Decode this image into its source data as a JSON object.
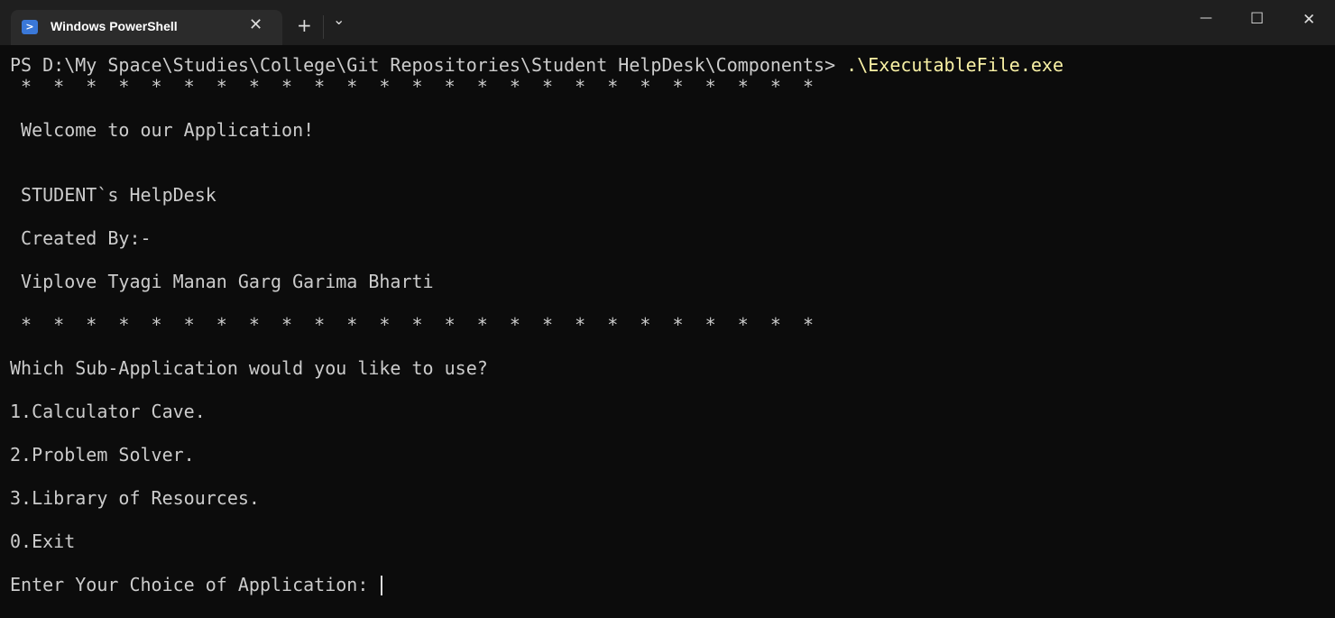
{
  "window": {
    "tab_title": "Windows PowerShell",
    "tab_icon": "powershell-icon",
    "new_tab": "+",
    "dropdown": "⌄",
    "minimize": "—",
    "maximize": "☐",
    "close": "✕",
    "tab_close": "✕"
  },
  "terminal": {
    "prompt": "PS D:\\My Space\\Studies\\College\\Git Repositories\\Student HelpDesk\\Components> ",
    "command": ".\\ExecutableFile.exe",
    "lines": [
      " *  *  *  *  *  *  *  *  *  *  *  *  *  *  *  *  *  *  *  *  *  *  *  *  *",
      "",
      " Welcome to our Application!",
      "",
      "",
      " STUDENT`s HelpDesk",
      "",
      " Created By:-",
      "",
      " Viplove Tyagi Manan Garg Garima Bharti",
      "",
      " *  *  *  *  *  *  *  *  *  *  *  *  *  *  *  *  *  *  *  *  *  *  *  *  *",
      "",
      "Which Sub-Application would you like to use?",
      "",
      "1.Calculator Cave.",
      "",
      "2.Problem Solver.",
      "",
      "3.Library of Resources.",
      "",
      "0.Exit",
      ""
    ],
    "input_prompt": "Enter Your Choice of Application: "
  }
}
